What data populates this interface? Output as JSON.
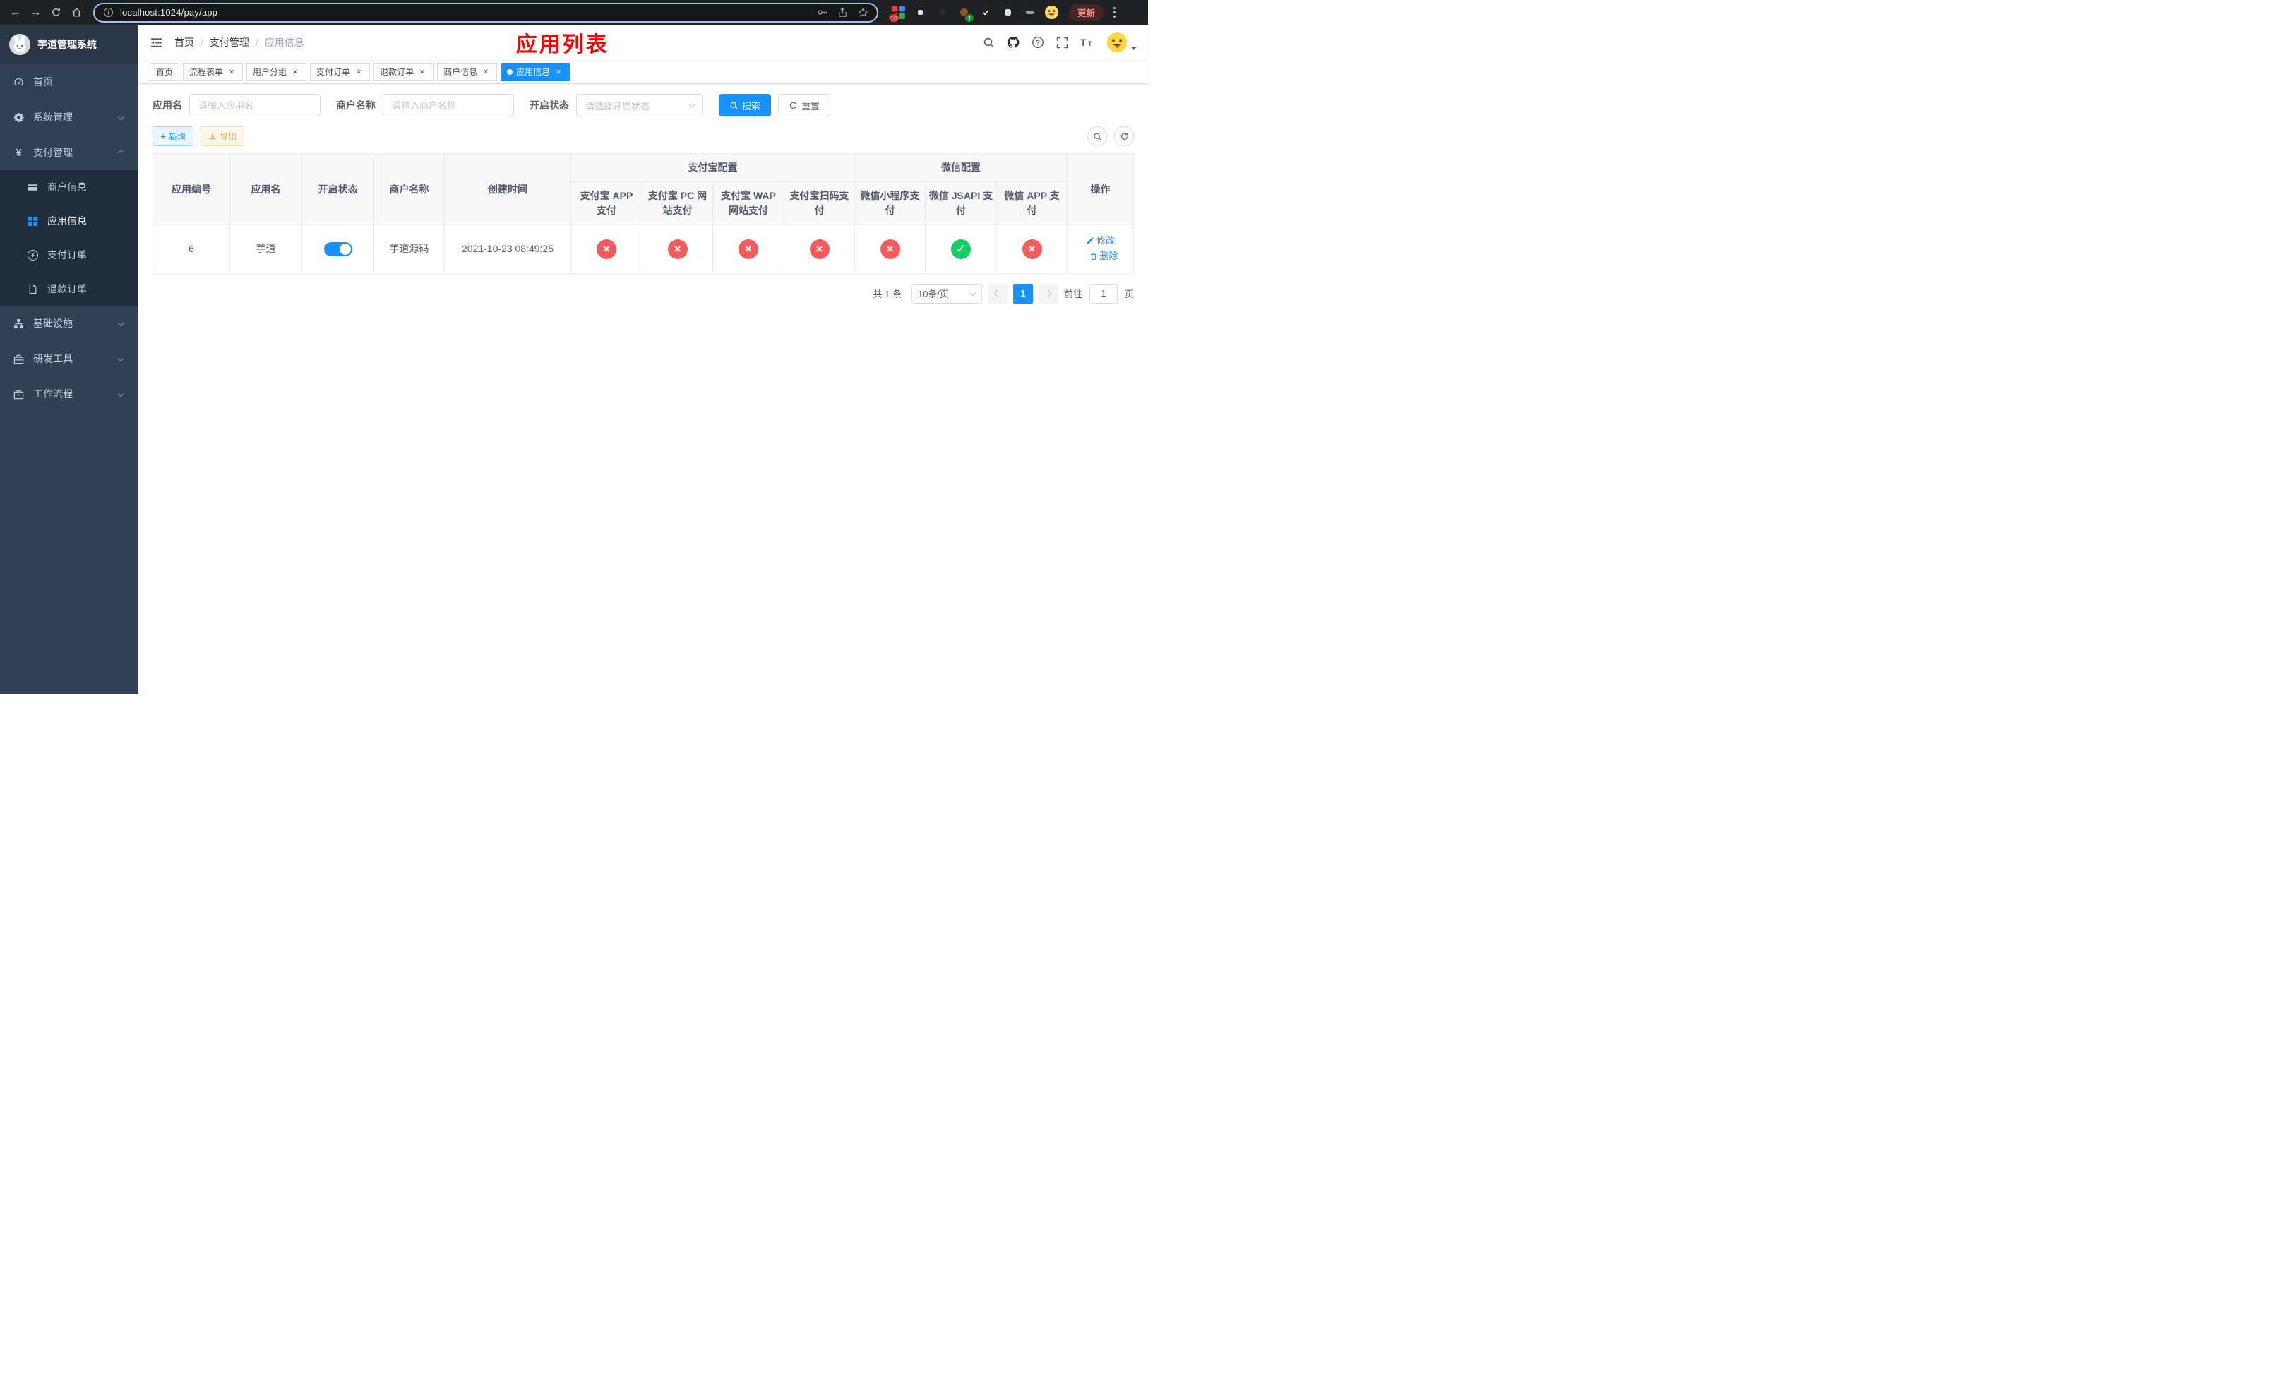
{
  "colors": {
    "primary": "#1890ff",
    "success": "#13ce66",
    "danger": "#f75b5b",
    "warning": "#e6a23c",
    "annotation": "#ff0000",
    "sidebar_bg": "#304156",
    "submenu_bg": "#1f2d3d"
  },
  "icons": {
    "back": "←",
    "forward": "→",
    "yen": "¥",
    "close": "×",
    "check": "✓",
    "cross": "×"
  },
  "browser": {
    "url": "localhost:1024/pay/app",
    "update_label": "更新",
    "extension_badge": "10",
    "avatar_badge": "1"
  },
  "sidebar": {
    "title": "芋道管理系统",
    "items": [
      {
        "label": "首页",
        "active": false
      },
      {
        "label": "系统管理",
        "expandable": true
      },
      {
        "label": "支付管理",
        "expandable": true,
        "expanded": true
      },
      {
        "label": "基础设施",
        "expandable": true
      },
      {
        "label": "研发工具",
        "expandable": true
      },
      {
        "label": "工作流程",
        "expandable": true
      }
    ],
    "payment_children": [
      {
        "label": "商户信息",
        "active": false
      },
      {
        "label": "应用信息",
        "active": true
      },
      {
        "label": "支付订单",
        "active": false
      },
      {
        "label": "退款订单",
        "active": false
      }
    ]
  },
  "navbar": {
    "breadcrumb": [
      "首页",
      "支付管理",
      "应用信息"
    ],
    "separator": "/",
    "annotation": "应用列表"
  },
  "tabs": [
    {
      "label": "首页",
      "closable": false,
      "active": false
    },
    {
      "label": "流程表单",
      "closable": true,
      "active": false
    },
    {
      "label": "用户分组",
      "closable": true,
      "active": false
    },
    {
      "label": "支付订单",
      "closable": true,
      "active": false
    },
    {
      "label": "退款订单",
      "closable": true,
      "active": false
    },
    {
      "label": "商户信息",
      "closable": true,
      "active": false
    },
    {
      "label": "应用信息",
      "closable": true,
      "active": true
    }
  ],
  "filters": {
    "app_name_label": "应用名",
    "app_name_placeholder": "请输入应用名",
    "merchant_label": "商户名称",
    "merchant_placeholder": "请输入商户名称",
    "status_label": "开启状态",
    "status_placeholder": "请选择开启状态",
    "search_label": "搜索",
    "reset_label": "重置"
  },
  "toolbar": {
    "add_label": "新增",
    "export_label": "导出"
  },
  "table": {
    "columns": [
      "应用编号",
      "应用名",
      "开启状态",
      "商户名称",
      "创建时间"
    ],
    "groups": [
      {
        "label": "支付宝配置",
        "children": [
          "支付宝 APP 支付",
          "支付宝 PC 网站支付",
          "支付宝 WAP 网站支付",
          "支付宝扫码支付"
        ]
      },
      {
        "label": "微信配置",
        "children": [
          "微信小程序支付",
          "微信 JSAPI 支付",
          "微信 APP 支付"
        ]
      }
    ],
    "action_column": "操作",
    "rows": [
      {
        "id": "6",
        "name": "芋道",
        "enabled": true,
        "merchant": "芋道源码",
        "created": "2021-10-23 08:49:25",
        "channels": [
          false,
          false,
          false,
          false,
          false,
          true,
          false
        ],
        "edit_label": "修改",
        "delete_label": "删除"
      }
    ]
  },
  "pagination": {
    "total_label": "共 1 条",
    "page_size_label": "10条/页",
    "current_page": "1",
    "goto_label": "前往",
    "goto_value": "1",
    "page_unit": "页"
  }
}
